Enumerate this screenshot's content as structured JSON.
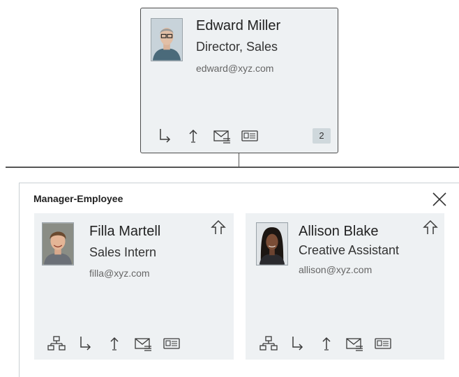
{
  "top_card": {
    "name": "Edward Miller",
    "title": "Director, Sales",
    "email": "edward@xyz.com",
    "badge_count": "2",
    "icons": [
      "show-reports-icon",
      "move-up-icon",
      "email-icon",
      "profile-card-icon"
    ]
  },
  "panel": {
    "title": "Manager-Employee",
    "close_icon": "close-icon"
  },
  "employees": [
    {
      "name": "Filla Martell",
      "title": "Sales Intern",
      "email": "filla@xyz.com",
      "icons": [
        "org-chart-icon",
        "show-reports-icon",
        "move-up-icon",
        "email-icon",
        "profile-card-icon"
      ],
      "action_icon": "promote-arrow-icon"
    },
    {
      "name": "Allison Blake",
      "title": "Creative Assistant",
      "email": "allison@xyz.com",
      "icons": [
        "org-chart-icon",
        "show-reports-icon",
        "move-up-icon",
        "email-icon",
        "profile-card-icon"
      ],
      "action_icon": "promote-arrow-icon"
    }
  ],
  "colors": {
    "card_bg": "#eef1f3",
    "border_dark": "#4b4b4b",
    "icon_stroke": "#3a3a3a",
    "badge_bg": "#cfd8dc"
  }
}
